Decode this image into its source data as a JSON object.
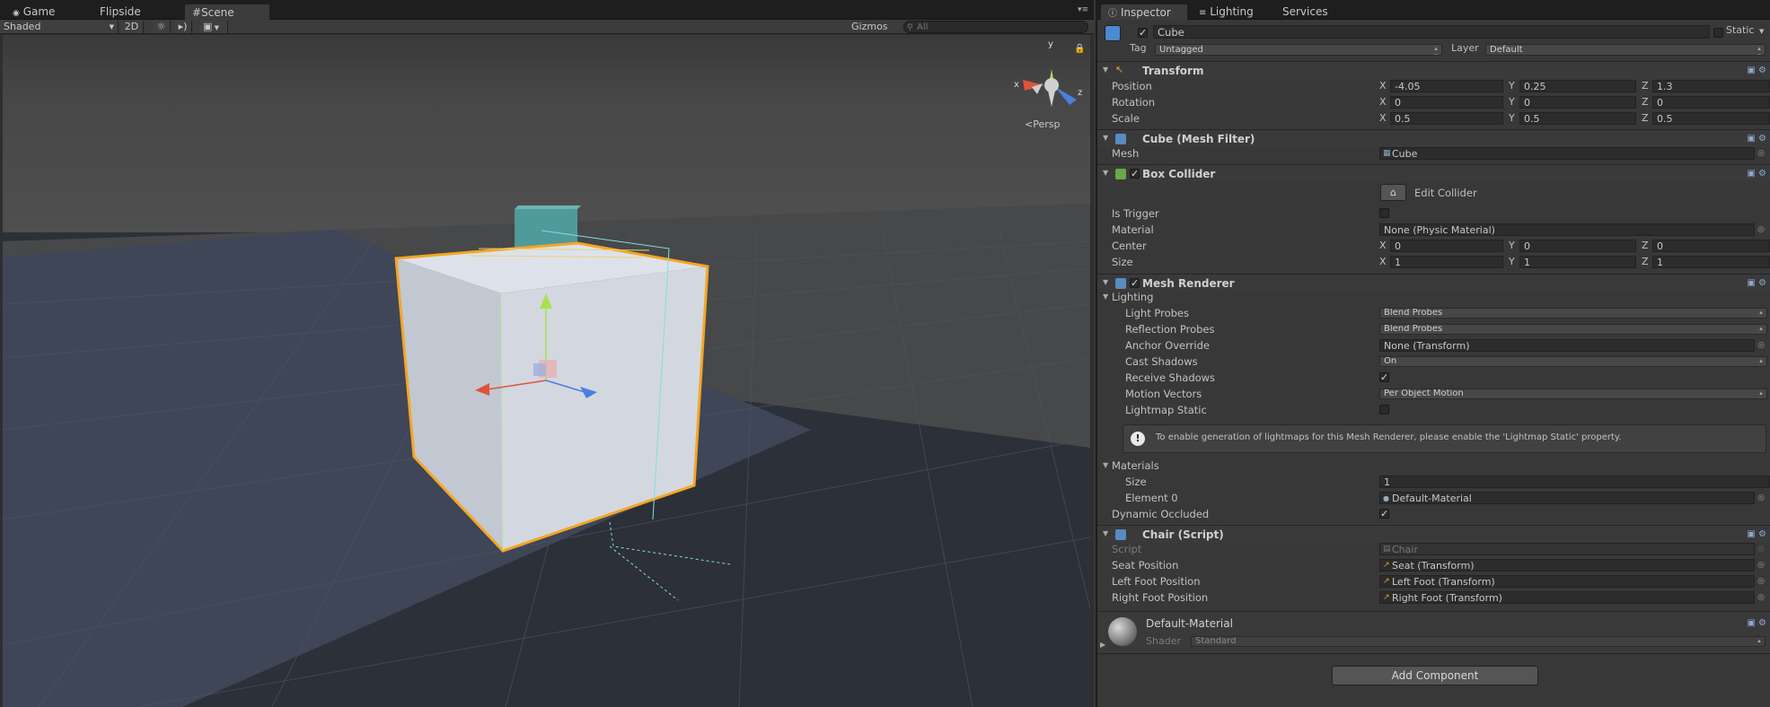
{
  "scene_tabs": [
    {
      "label": "Game"
    },
    {
      "label": "Flipside"
    },
    {
      "label": "Scene"
    }
  ],
  "scene_toolbar": {
    "shading": "Shaded",
    "mode_2d": "2D",
    "gizmos": "Gizmos",
    "search_placeholder": "All"
  },
  "viewport": {
    "projection": "Persp",
    "axes": {
      "y": "y",
      "x": "x",
      "z": "z"
    }
  },
  "inspector_tabs": [
    {
      "label": "Inspector"
    },
    {
      "label": "Lighting"
    },
    {
      "label": "Services"
    }
  ],
  "object": {
    "name": "Cube",
    "active": true,
    "static_label": "Static",
    "tag_label": "Tag",
    "tag": "Untagged",
    "layer_label": "Layer",
    "layer": "Default"
  },
  "transform": {
    "title": "Transform",
    "position": {
      "label": "Position",
      "x": "-4.05",
      "y": "0.25",
      "z": "1.3"
    },
    "rotation": {
      "label": "Rotation",
      "x": "0",
      "y": "0",
      "z": "0"
    },
    "scale": {
      "label": "Scale",
      "x": "0.5",
      "y": "0.5",
      "z": "0.5"
    }
  },
  "axis_labels": {
    "x": "X",
    "y": "Y",
    "z": "Z"
  },
  "mesh_filter": {
    "title": "Cube (Mesh Filter)",
    "mesh_label": "Mesh",
    "mesh": "Cube"
  },
  "box_collider": {
    "title": "Box Collider",
    "edit_label": "Edit Collider",
    "is_trigger_label": "Is Trigger",
    "material_label": "Material",
    "material": "None (Physic Material)",
    "center": {
      "label": "Center",
      "x": "0",
      "y": "0",
      "z": "0"
    },
    "size": {
      "label": "Size",
      "x": "1",
      "y": "1",
      "z": "1"
    }
  },
  "mesh_renderer": {
    "title": "Mesh Renderer",
    "lighting_label": "Lighting",
    "light_probes_label": "Light Probes",
    "light_probes": "Blend Probes",
    "reflection_probes_label": "Reflection Probes",
    "reflection_probes": "Blend Probes",
    "anchor_override_label": "Anchor Override",
    "anchor_override": "None (Transform)",
    "cast_shadows_label": "Cast Shadows",
    "cast_shadows": "On",
    "receive_shadows_label": "Receive Shadows",
    "motion_vectors_label": "Motion Vectors",
    "motion_vectors": "Per Object Motion",
    "lightmap_static_label": "Lightmap Static",
    "info": "To enable generation of lightmaps for this Mesh Renderer, please enable the 'Lightmap Static' property.",
    "materials_label": "Materials",
    "size_label": "Size",
    "size": "1",
    "element0_label": "Element 0",
    "element0": "Default-Material",
    "dynamic_occluded_label": "Dynamic Occluded"
  },
  "chair_script": {
    "title": "Chair (Script)",
    "script_label": "Script",
    "script": "Chair",
    "seat_label": "Seat Position",
    "seat": "Seat  (Transform)",
    "left_foot_label": "Left Foot Position",
    "left_foot": "Left Foot (Transform)",
    "right_foot_label": "Right Foot Position",
    "right_foot": "Right Foot (Transform)"
  },
  "material": {
    "name": "Default-Material",
    "shader_label": "Shader",
    "shader": "Standard"
  },
  "add_component": "Add Component",
  "colors": {
    "selection": "#f5a623",
    "cube": "#cdd3dc",
    "teal": "#4a9b9b"
  }
}
